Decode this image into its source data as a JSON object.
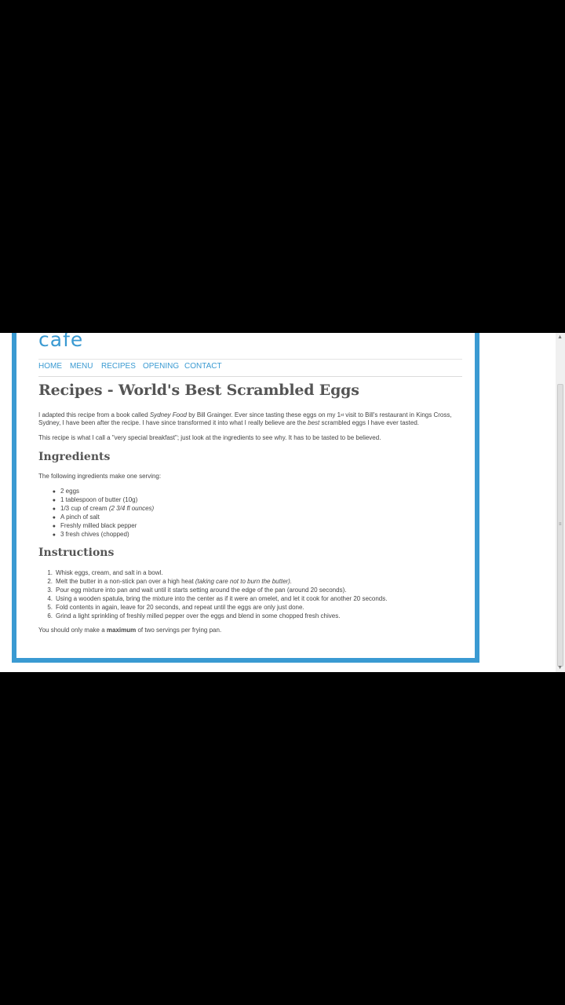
{
  "site": {
    "logo": "cafe",
    "nav": [
      "HOME",
      "MENU",
      "RECIPES",
      "OPENING",
      "CONTACT"
    ]
  },
  "page": {
    "title": "Recipes - World's Best Scrambled Eggs",
    "intro": {
      "a": "I adapted this recipe from a book called ",
      "book": "Sydney Food",
      "b": " by Bill Grainger. Ever since tasting these eggs on my 1",
      "sup": "st",
      "c": " visit to Bill's restaurant in Kings Cross, Sydney, I have been after the recipe. I have since transformed it into what I really believe are the ",
      "best": "best",
      "d": " scrambled eggs I have ever tasted."
    },
    "note": "This recipe is what I call a \"very special breakfast\"; just look at the ingredients to see why. It has to be tasted to be believed.",
    "ingredients_heading": "Ingredients",
    "ingredients_intro": "The following ingredients make one serving:",
    "ingredients": [
      {
        "text": "2 eggs",
        "italic": ""
      },
      {
        "text": "1 tablespoon of butter (10g)",
        "italic": ""
      },
      {
        "text": "1/3 cup of cream ",
        "italic": "(2 3/4 fl ounces)"
      },
      {
        "text": "A pinch of salt",
        "italic": ""
      },
      {
        "text": "Freshly milled black pepper",
        "italic": ""
      },
      {
        "text": "3 fresh chives (chopped)",
        "italic": ""
      }
    ],
    "instructions_heading": "Instructions",
    "instructions": [
      {
        "num": "1.",
        "text": "Whisk eggs, cream, and salt in a bowl.",
        "italic": ""
      },
      {
        "num": "2.",
        "text": "Melt the butter in a non-stick pan over a high heat ",
        "italic": "(taking care not to burn the butter)."
      },
      {
        "num": "3.",
        "text": "Pour egg mixture into pan and wait until it starts setting around the edge of the pan (around 20 seconds).",
        "italic": ""
      },
      {
        "num": "4.",
        "text": "Using a wooden spatula, bring the mixture into the center as if it were an omelet, and let it cook for another 20 seconds.",
        "italic": ""
      },
      {
        "num": "5.",
        "text": "Fold contents in again, leave for 20 seconds, and repeat until the eggs are only just done.",
        "italic": ""
      },
      {
        "num": "6.",
        "text": "Grind a light sprinkling of freshly milled pepper over the eggs and blend in some chopped fresh chives.",
        "italic": ""
      }
    ],
    "footer": {
      "a": "You should only make a ",
      "bold": "maximum",
      "b": " of two servings per frying pan."
    }
  },
  "scrollbar": {
    "up_icon": "▲",
    "down_icon": "▼",
    "grip_icon": "≡"
  }
}
